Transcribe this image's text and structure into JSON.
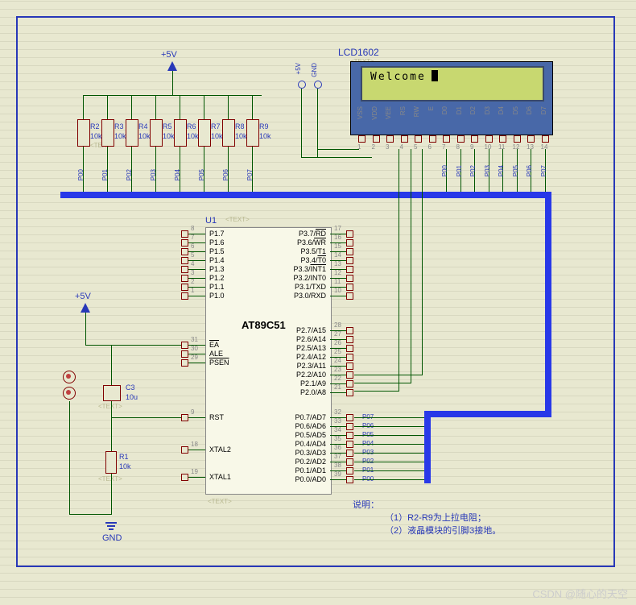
{
  "power": {
    "v5": "+5V",
    "gnd": "GND"
  },
  "lcd": {
    "label": "LCD1602",
    "text": "Welcome",
    "pins": [
      "VSS",
      "VDD",
      "VEE",
      "RS",
      "RW",
      "E",
      "D0",
      "D1",
      "D2",
      "D3",
      "D4",
      "D5",
      "D6",
      "D7"
    ],
    "pinNums": [
      "1",
      "2",
      "3",
      "4",
      "5",
      "6",
      "7",
      "8",
      "9",
      "10",
      "11",
      "12",
      "13",
      "14"
    ]
  },
  "resistors": {
    "r1": {
      "name": "R1",
      "val": "10k"
    },
    "r2": {
      "name": "R2",
      "val": "10k"
    },
    "r3": {
      "name": "R3",
      "val": "10k"
    },
    "r4": {
      "name": "R4",
      "val": "10k"
    },
    "r5": {
      "name": "R5",
      "val": "10k"
    },
    "r6": {
      "name": "R6",
      "val": "10k"
    },
    "r7": {
      "name": "R7",
      "val": "10k"
    },
    "r8": {
      "name": "R8",
      "val": "10k"
    },
    "r9": {
      "name": "R9",
      "val": "10k"
    }
  },
  "capacitor": {
    "name": "C3",
    "val": "10u"
  },
  "chip": {
    "ref": "U1",
    "name": "AT89C51",
    "leftPins": [
      {
        "num": "8",
        "name": "P1.7"
      },
      {
        "num": "7",
        "name": "P1.6"
      },
      {
        "num": "6",
        "name": "P1.5"
      },
      {
        "num": "5",
        "name": "P1.4"
      },
      {
        "num": "4",
        "name": "P1.3"
      },
      {
        "num": "3",
        "name": "P1.2"
      },
      {
        "num": "2",
        "name": "P1.1"
      },
      {
        "num": "1",
        "name": "P1.0"
      },
      {
        "num": "31",
        "name": "EA",
        "ov": true
      },
      {
        "num": "30",
        "name": "ALE"
      },
      {
        "num": "29",
        "name": "PSEN",
        "ov": true
      },
      {
        "num": "9",
        "name": "RST"
      },
      {
        "num": "18",
        "name": "XTAL2"
      },
      {
        "num": "19",
        "name": "XTAL1"
      }
    ],
    "rightPinsTop": [
      {
        "num": "17",
        "name": "P3.7/RD",
        "ov": "RD"
      },
      {
        "num": "16",
        "name": "P3.6/WR",
        "ov": "WR"
      },
      {
        "num": "15",
        "name": "P3.5/T1"
      },
      {
        "num": "14",
        "name": "P3.4/T0",
        "ov": "T0"
      },
      {
        "num": "13",
        "name": "P3.3/INT1",
        "ov": "INT1"
      },
      {
        "num": "12",
        "name": "P3.2/INT0"
      },
      {
        "num": "11",
        "name": "P3.1/TXD"
      },
      {
        "num": "10",
        "name": "P3.0/RXD"
      }
    ],
    "rightPinsMid": [
      {
        "num": "28",
        "name": "P2.7/A15"
      },
      {
        "num": "27",
        "name": "P2.6/A14"
      },
      {
        "num": "26",
        "name": "P2.5/A13"
      },
      {
        "num": "25",
        "name": "P2.4/A12"
      },
      {
        "num": "24",
        "name": "P2.3/A11"
      },
      {
        "num": "23",
        "name": "P2.2/A10"
      },
      {
        "num": "22",
        "name": "P2.1/A9"
      },
      {
        "num": "21",
        "name": "P2.0/A8"
      }
    ],
    "rightPinsBot": [
      {
        "num": "32",
        "name": "P0.7/AD7",
        "net": "P07"
      },
      {
        "num": "33",
        "name": "P0.6/AD6",
        "net": "P06"
      },
      {
        "num": "34",
        "name": "P0.5/AD5",
        "net": "P05"
      },
      {
        "num": "35",
        "name": "P0.4/AD4",
        "net": "P04"
      },
      {
        "num": "36",
        "name": "P0.3/AD3",
        "net": "P03"
      },
      {
        "num": "37",
        "name": "P0.2/AD2",
        "net": "P02"
      },
      {
        "num": "38",
        "name": "P0.1/AD1",
        "net": "P01"
      },
      {
        "num": "39",
        "name": "P0.0/AD0",
        "net": "P00"
      }
    ]
  },
  "busNets": [
    "P00",
    "P01",
    "P02",
    "P03",
    "P04",
    "P05",
    "P06",
    "P07"
  ],
  "notes": {
    "title": "说明：",
    "line1": "（1）R2-R9为上拉电阻；",
    "line2": "（2）液晶模块的引脚3接地。"
  },
  "watermark": "CSDN @随心的天空",
  "textLabel": "<TEXT>"
}
